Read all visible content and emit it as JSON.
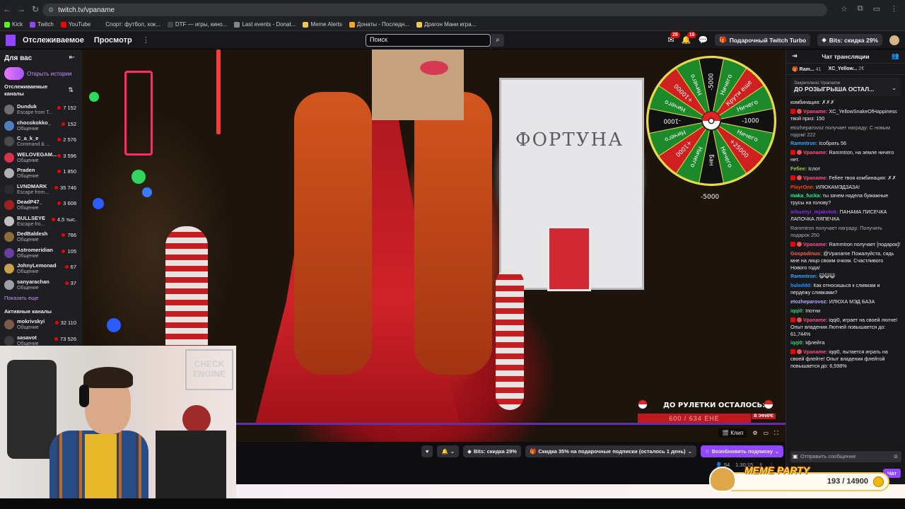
{
  "browser": {
    "url": "twitch.tv/vpaname",
    "bookmarks": [
      "Kick",
      "Twitch",
      "YouTube",
      "Спорт: футбол, хок...",
      "DTF — игры, кино...",
      "Last events - Donat...",
      "Meme Alerts",
      "Донаты - Последн...",
      "Драгон Мани игра..."
    ],
    "bookmark_colors": [
      "#53fc18",
      "#9146ff",
      "#ff0000",
      "#222",
      "#444",
      "#888",
      "#f2c94c",
      "#f5a623",
      "#f2c94c"
    ]
  },
  "header": {
    "nav_following": "Отслеживаемое",
    "nav_browse": "Просмотр",
    "more": "⋮",
    "search_placeholder": "Поиск",
    "notif_badge_1": "28",
    "notif_badge_2": "16",
    "gift_turbo": "Подарочный Twitch Turbo",
    "bits_discount": "Bits: скидка 29%"
  },
  "sidebar": {
    "title": "Для вас",
    "stories_label": "Открыть истории",
    "followed_title": "Отслеживаемые каналы",
    "channels": [
      {
        "name": "Dunduk",
        "category": "Escape from T...",
        "viewers": "7 152",
        "color": "#6f6f6f"
      },
      {
        "name": "chocokokko_",
        "category": "Общение",
        "viewers": "152",
        "color": "#4d7fbf"
      },
      {
        "name": "C_a_k_e",
        "category": "Command & ...",
        "viewers": "2 576",
        "color": "#4a4a4a"
      },
      {
        "name": "WELOVEGAM...",
        "category": "Общение",
        "viewers": "3 596",
        "color": "#d9334a"
      },
      {
        "name": "Praden",
        "category": "Общение",
        "viewers": "1 850",
        "color": "#b0b0b0"
      },
      {
        "name": "LVNDMARK",
        "category": "Escape from...",
        "viewers": "35 746",
        "color": "#2b2b2b"
      },
      {
        "name": "DeadP47_",
        "category": "Общение",
        "viewers": "3 608",
        "color": "#a02020"
      },
      {
        "name": "BULLSEYE",
        "category": "Escape fro...",
        "viewers": "4,5 тыс.",
        "color": "#c0c0c0"
      },
      {
        "name": "DedBaldesh",
        "category": "Общение",
        "viewers": "766",
        "color": "#8a6d3b"
      },
      {
        "name": "Astromeridian",
        "category": "Общение",
        "viewers": "105",
        "color": "#6b3fa0"
      },
      {
        "name": "JohnyLemonade",
        "category": "Общение",
        "viewers": "67",
        "color": "#c7a24a"
      },
      {
        "name": "sanyarachan",
        "category": "Общение",
        "viewers": "37",
        "color": "#9fa0a5"
      }
    ],
    "show_more": "Показать еще",
    "active_title": "Активные каналы",
    "active_channels": [
      {
        "name": "mokrivskyi",
        "category": "Общение",
        "viewers": "32 110",
        "color": "#7a5a4a"
      },
      {
        "name": "sasavot",
        "category": "Общение",
        "viewers": "73 526",
        "color": "#3a3a3a"
      }
    ]
  },
  "video": {
    "board_text": "ФОРТУНА",
    "wheel_sectors": [
      "-5000",
      "Ничего",
      "Крути еще",
      "Ничего",
      "-1000",
      "Ничего",
      "+25000",
      "Ничего",
      "Бан",
      "Ничего",
      "+1000",
      "Ничего",
      "-1000",
      "Ничего",
      "+10000",
      "Ничего"
    ],
    "wheel_score": "-5000",
    "countdown_label": "ДО РУЛЕТКИ ОСТАЛОСЬ:",
    "countdown_value": "600 / 634 ЕНЕ",
    "live_label": "В ЭФИРЕ",
    "clip_label": "Клип"
  },
  "below_video": {
    "bits_btn": "Bits: скидка 29%",
    "gift_btn": "Скидка 35% на подарочные подписки (осталось 1 день)",
    "resub_btn": "Возобновить подписку",
    "viewers": "54",
    "uptime": "1:30:15"
  },
  "webcam": {
    "sign_text": "CHECK ENGINE"
  },
  "chat": {
    "title": "Чат трансляции",
    "gift_user_1": "Ram...",
    "gift_count_1": "41",
    "gift_user_2": "XC_Yellow...",
    "gift_count_2": "2€",
    "pinned_by": "Закреплено Vpaname",
    "pinned_text": "ДО РОЗЫГРЫША ОСТАЛ...",
    "messages": [
      {
        "user": "",
        "color": "#efeff1",
        "text": "комбинация: ✗✗✗",
        "badge": false
      },
      {
        "user": "Vpaname:",
        "color": "#ff4f8a",
        "text": " XC_YellowSnakeOfHappiness твой приз: 150",
        "badge": true
      },
      {
        "user": "",
        "color": "#adadb8",
        "text": "etozheparovoz получает награду: С новым годом! 222",
        "badge": false,
        "sys": true
      },
      {
        "user": "Rammtron:",
        "color": "#2ea3ff",
        "text": " Ісобрать 56",
        "badge": false
      },
      {
        "user": "Vpaname:",
        "color": "#ff4f8a",
        "text": " Rammtron, на земле ничего нет.",
        "badge": true
      },
      {
        "user": "Fefiee:",
        "color": "#9acd32",
        "text": " Іслот",
        "badge": false
      },
      {
        "user": "Vpaname:",
        "color": "#ff4f8a",
        "text": " Fefiee твоя комбинация: ✗✗",
        "badge": true
      },
      {
        "user": "PlayrOne:",
        "color": "#ff4500",
        "text": " ИЛЮКАМЭДЗАЗА!",
        "badge": false
      },
      {
        "user": "maka_fucka:",
        "color": "#00ff7f",
        "text": " ты зачем надела бумажные трусы на голову?",
        "badge": false
      },
      {
        "user": "arbuznyi_mjakotok:",
        "color": "#8a2be2",
        "text": " ПАНАМА ПИСЕЧКА ЛАПОЧКА ЛЯПЕЧКА",
        "badge": false
      },
      {
        "user": "",
        "color": "#adadb8",
        "text": "Rammtron получает награду: Получить подарок 250",
        "badge": false,
        "sys": true
      },
      {
        "user": "Vpaname:",
        "color": "#ff4f8a",
        "text": " Rammtron получает [подарок]!",
        "badge": true
      },
      {
        "user": "Gospodinus:",
        "color": "#ff6347",
        "text": " @Vpaname Пожалуйста, сядь мне на лицо своим очком. Счастливого Нового года!",
        "badge": false
      },
      {
        "user": "Rammtron:",
        "color": "#2ea3ff",
        "text": " 😺😺😺",
        "badge": false
      },
      {
        "user": "buladdd:",
        "color": "#1e90ff",
        "text": " Как относишься к сливкам и пердежу сливками?",
        "badge": false
      },
      {
        "user": "etozheparovoz:",
        "color": "#b0b0ff",
        "text": " ИЛЮХА МЭД БАЗА",
        "badge": false
      },
      {
        "user": "iqqi0:",
        "color": "#2ecc71",
        "text": " Іпотни",
        "badge": false
      },
      {
        "user": "Vpaname:",
        "color": "#ff4f8a",
        "text": " iqqi0, играет на своей лютне! Опыт владения Лютней повышается до: 61,744%",
        "badge": true
      },
      {
        "user": "iqqi0:",
        "color": "#2ecc71",
        "text": " Іфлейта",
        "badge": false
      },
      {
        "user": "Vpaname:",
        "color": "#ff4f8a",
        "text": " iqqi0, пытается играть на своей флейте! Опыт владения флейтой повышается до: 6,598%",
        "badge": true
      }
    ],
    "input_placeholder": "Отправить сообщение",
    "chat_button": "Чат"
  },
  "meme_widget": {
    "title": "MEME PARTY",
    "value": "193 / 14900"
  }
}
